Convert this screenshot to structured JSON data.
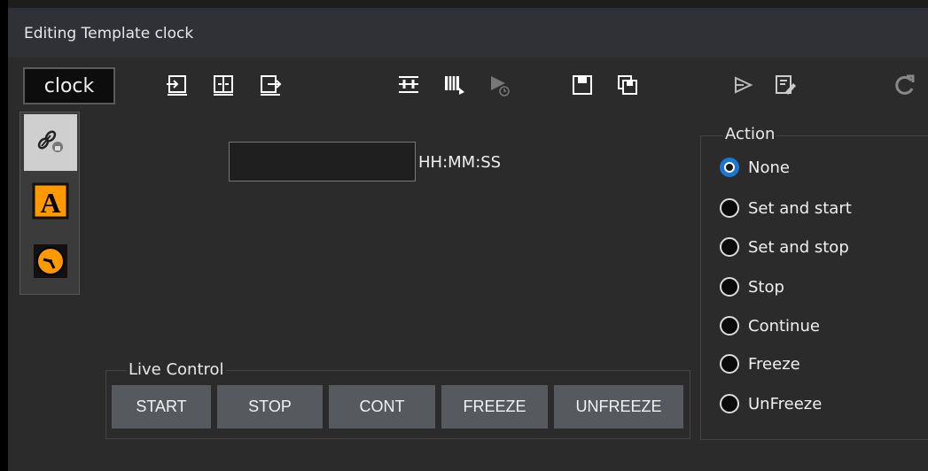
{
  "window": {
    "title": "Editing Template clock"
  },
  "template_name": "clock",
  "toolbar": {
    "icons": [
      "import-icon",
      "split-icon",
      "export-icon",
      "merge-icon",
      "film-icon",
      "play-timer-icon",
      "save-icon",
      "save-as-icon",
      "send-icon",
      "edit-icon",
      "refresh-icon"
    ]
  },
  "side_tabs": [
    {
      "icon": "link-icon",
      "active": true
    },
    {
      "icon": "text-a-icon",
      "active": false
    },
    {
      "icon": "clock-icon",
      "active": false
    }
  ],
  "time_field": {
    "value": "",
    "format_label": "HH:MM:SS"
  },
  "action": {
    "title": "Action",
    "selected": "None",
    "options": [
      "None",
      "Set and start",
      "Set and stop",
      "Stop",
      "Continue",
      "Freeze",
      "UnFreeze"
    ]
  },
  "live_control": {
    "title": "Live Control",
    "buttons": [
      "START",
      "STOP",
      "CONT",
      "FREEZE",
      "UNFREEZE"
    ]
  },
  "colors": {
    "accent": "#1976d2",
    "orange": "#ff9900",
    "button_bg": "#565a5f"
  }
}
